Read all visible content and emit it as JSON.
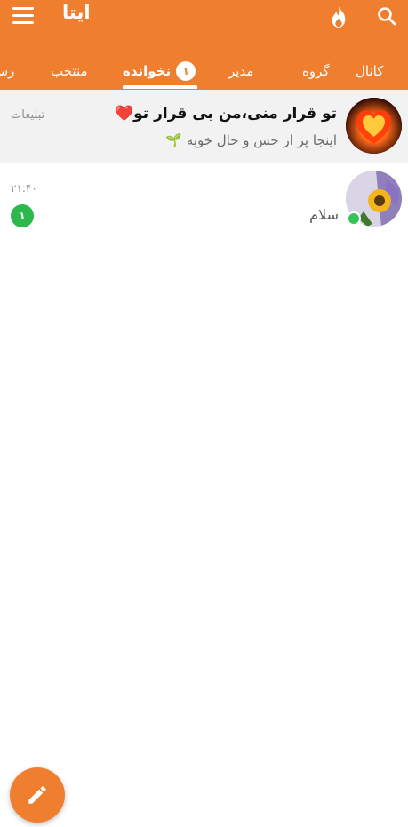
{
  "app": {
    "title": "ایتا"
  },
  "tabs": [
    {
      "label": "کانال"
    },
    {
      "label": "گروه"
    },
    {
      "label": "مدیر"
    },
    {
      "label": "نخوانده",
      "badge": "۱"
    },
    {
      "label": "منتخب"
    },
    {
      "label": "رسا"
    }
  ],
  "ad": {
    "label": "تبلیغات",
    "title": "تو قرار منی،من بی قرار تو",
    "title_emoji": "❤️",
    "subtitle": "اینجا پر از حس و حال خوبه",
    "subtitle_emoji": "🌱"
  },
  "chat": {
    "message": "سلام",
    "time": "۲۱:۴۰",
    "unread": "۱",
    "online": true
  },
  "icons": {
    "menu": "menu-icon",
    "fire": "fire-icon",
    "search": "search-icon",
    "compose": "pencil-icon"
  },
  "colors": {
    "accent": "#ef7f2f",
    "online": "#36c35a",
    "unread_badge": "#2db84d"
  }
}
